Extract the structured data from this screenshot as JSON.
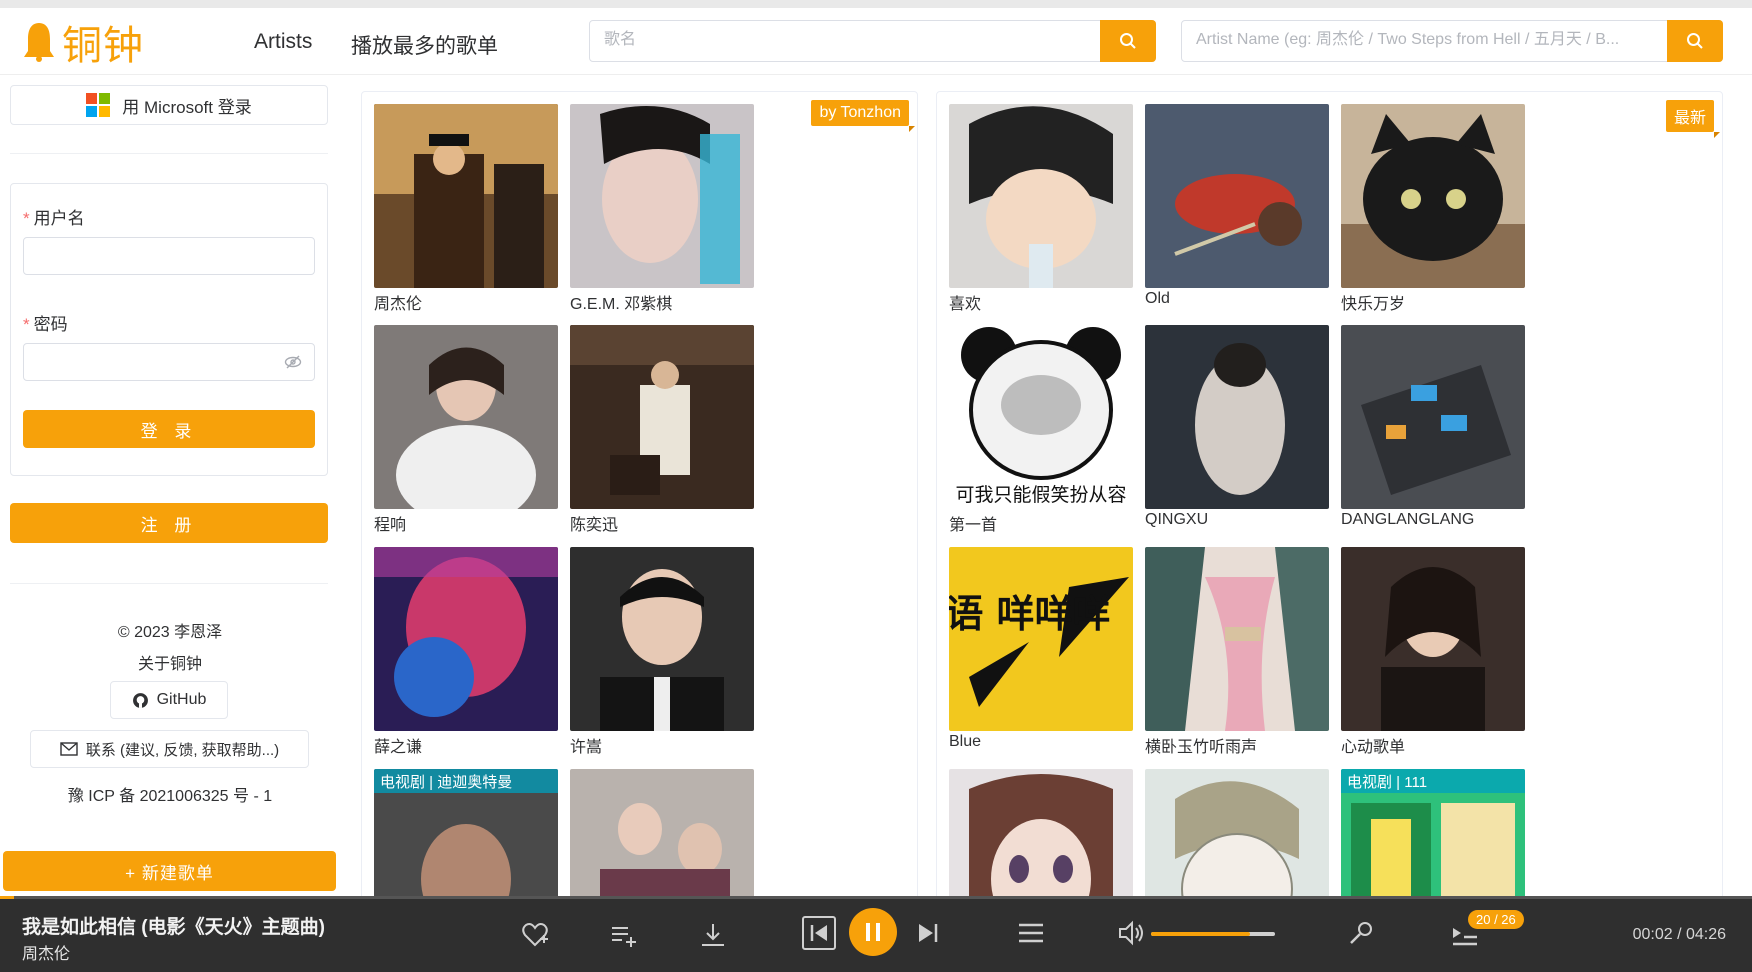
{
  "header": {
    "logo_text": "铜钟",
    "nav": [
      "Artists",
      "播放最多的歌单"
    ],
    "song_search_placeholder": "歌名",
    "artist_search_placeholder": "Artist Name (eg: 周杰伦 / Two Steps from Hell / 五月天 / B...",
    "brand_color": "#f7a10a"
  },
  "sidebar": {
    "ms_login": "用 Microsoft 登录",
    "username_label": "用户名",
    "password_label": "密码",
    "login_button": "登 录",
    "register_button": "注 册",
    "copyright": "© 2023 李恩泽",
    "about": "关于铜钟",
    "github": "GitHub",
    "contact": "联系 (建议, 反馈, 获取帮助...)",
    "icp": "豫 ICP 备 2021006325 号 - 1",
    "new_playlist": "+ 新建歌单"
  },
  "artists_panel": {
    "ribbon": "by Tonzhon",
    "items": [
      {
        "name": "周杰伦"
      },
      {
        "name": "G.E.M. 邓紫棋"
      },
      {
        "name": "程响"
      },
      {
        "name": "陈奕迅"
      },
      {
        "name": "薛之谦"
      },
      {
        "name": "许嵩"
      },
      {
        "name": "",
        "tag": "电视剧 | 迪迦奥特曼"
      },
      {
        "name": ""
      }
    ]
  },
  "playlists_panel": {
    "ribbon": "最新",
    "items": [
      {
        "name": "喜欢"
      },
      {
        "name": "Old"
      },
      {
        "name": "快乐万岁"
      },
      {
        "name": "第一首",
        "overlay": "可我只能假笑扮从容"
      },
      {
        "name": "QINGXU"
      },
      {
        "name": "DANGLANGLANG"
      },
      {
        "name": "Blue",
        "overlay": "粤语 咩咩咩"
      },
      {
        "name": "横卧玉竹听雨声"
      },
      {
        "name": "心动歌单"
      },
      {
        "name": ""
      },
      {
        "name": ""
      },
      {
        "name": "",
        "tag": "电视剧 | 111"
      }
    ]
  },
  "player": {
    "title": "我是如此相信 (电影《天火》主题曲)",
    "artist": "周杰伦",
    "queue_count": "20 / 26",
    "time": "00:02 / 04:26",
    "volume": 0.8,
    "progress": 0.008,
    "icons": [
      "heart-plus-icon",
      "add-to-list-icon",
      "download-icon",
      "previous-icon",
      "pause-icon",
      "next-icon",
      "playlist-icon",
      "volume-icon",
      "search-icon",
      "queue-icon"
    ]
  }
}
